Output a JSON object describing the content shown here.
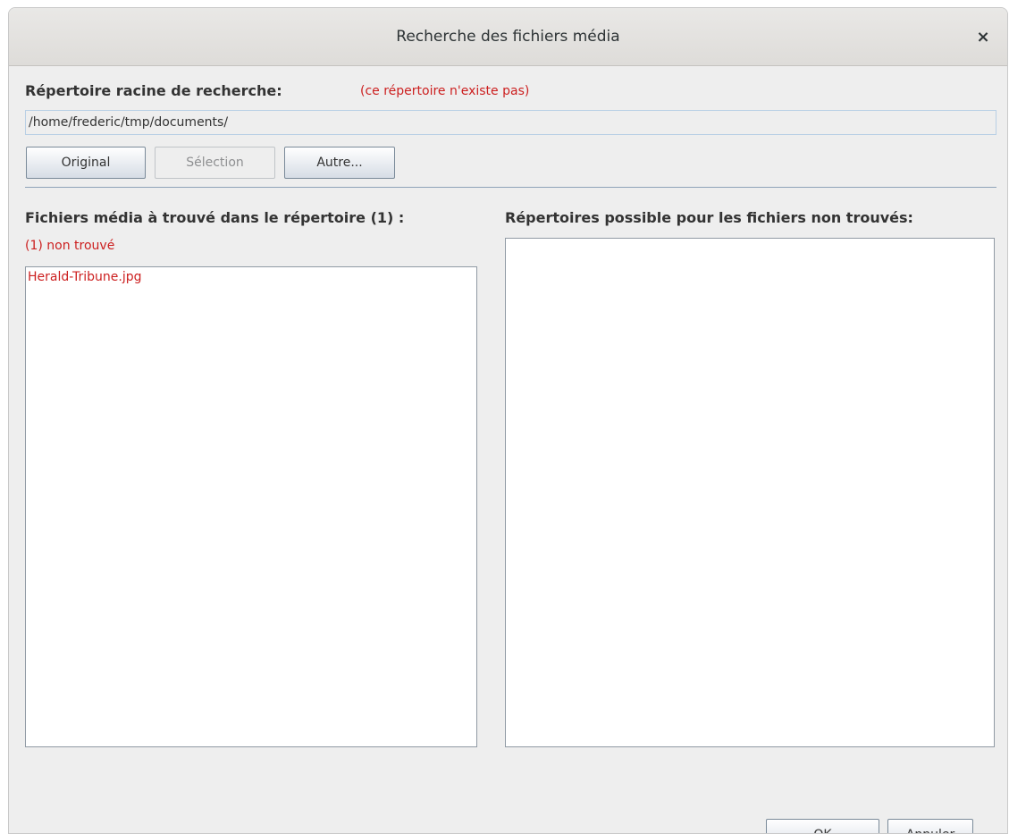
{
  "window": {
    "title": "Recherche des fichiers média",
    "close_glyph": "×",
    "close_icon": "close-icon"
  },
  "root": {
    "label": "Répertoire racine de recherche:",
    "warning": "(ce répertoire n'existe pas)",
    "path": "/home/frederic/tmp/documents/"
  },
  "buttons": {
    "original": "Original",
    "selection": "Sélection",
    "autre": "Autre..."
  },
  "files": {
    "header": "Fichiers média à trouvé dans le répertoire (1) :",
    "not_found": "(1) non trouvé",
    "items": [
      "Herald-Tribune.jpg"
    ]
  },
  "dirs": {
    "header": "Répertoires possible pour les fichiers non trouvés:",
    "items": []
  },
  "footer": {
    "ok": "OK",
    "cancel": "Annuler"
  },
  "colors": {
    "error_red": "#cc1f1f",
    "window_bg": "#eeeeee",
    "separator": "#8fa3b8"
  }
}
